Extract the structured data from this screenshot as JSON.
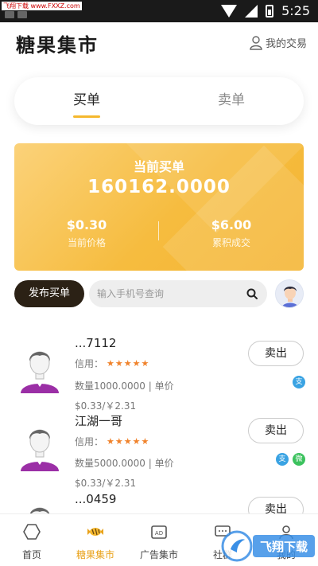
{
  "status_bar": {
    "watermark": "飞翔下载 www.FXXZ.com",
    "time": "5:25"
  },
  "header": {
    "title": "糖果集市",
    "my_trade": "我的交易"
  },
  "tabs": [
    {
      "label": "买单",
      "active": true
    },
    {
      "label": "卖单",
      "active": false
    }
  ],
  "banner": {
    "title": "当前买单",
    "amount": "160162.0000",
    "current_price_value": "$0.30",
    "current_price_label": "当前价格",
    "total_value": "$6.00",
    "total_label": "累积成交"
  },
  "actions": {
    "publish_label": "发布买单",
    "search_placeholder": "输入手机号查询"
  },
  "listings": [
    {
      "name": "...7112",
      "credit_label": "信用：",
      "stars": "★★★★★",
      "quantity": "数量1000.0000 | 单价",
      "price": "$0.33/￥2.31",
      "button": "卖出",
      "payments": [
        "alipay"
      ]
    },
    {
      "name": "江湖一哥",
      "credit_label": "信用：",
      "stars": "★★★★★",
      "quantity": "数量5000.0000 | 单价",
      "price": "$0.33/￥2.31",
      "button": "卖出",
      "payments": [
        "alipay",
        "wechat"
      ]
    },
    {
      "name": "...0459",
      "credit_label": "",
      "stars": "",
      "quantity": "",
      "price": "",
      "button": "卖出",
      "payments": []
    }
  ],
  "nav": [
    {
      "label": "首页",
      "icon": "home-icon",
      "active": false
    },
    {
      "label": "糖果集市",
      "icon": "candy-icon",
      "active": true
    },
    {
      "label": "广告集市",
      "icon": "ad-icon",
      "active": false
    },
    {
      "label": "社群",
      "icon": "chat-icon",
      "active": false
    },
    {
      "label": "我的",
      "icon": "profile-icon",
      "active": false
    }
  ],
  "overlay_logo": {
    "text": "飞翔下载"
  },
  "colors": {
    "accent": "#f5b82e",
    "active_nav": "#e9a21a",
    "dark_button": "#2b2115",
    "star": "#f0822b"
  }
}
